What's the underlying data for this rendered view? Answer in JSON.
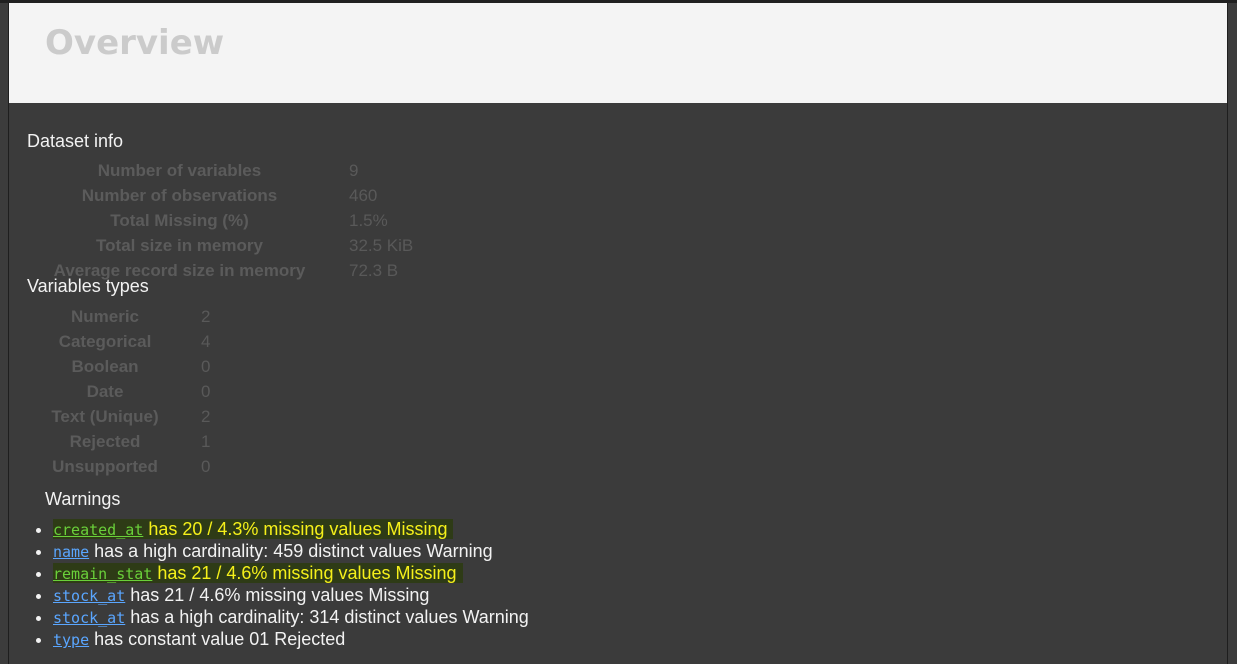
{
  "header": {
    "title": "Overview"
  },
  "dataset_info": {
    "title": "Dataset info",
    "rows": [
      {
        "label": "Number of variables",
        "value": "9"
      },
      {
        "label": "Number of observations",
        "value": "460"
      },
      {
        "label": "Total Missing (%)",
        "value": "1.5%"
      },
      {
        "label": "Total size in memory",
        "value": "32.5 KiB"
      },
      {
        "label": "Average record size in memory",
        "value": "72.3 B"
      }
    ]
  },
  "variable_types": {
    "title": "Variables types",
    "rows": [
      {
        "label": "Numeric",
        "value": "2"
      },
      {
        "label": "Categorical",
        "value": "4"
      },
      {
        "label": "Boolean",
        "value": "0"
      },
      {
        "label": "Date",
        "value": "0"
      },
      {
        "label": "Text (Unique)",
        "value": "2"
      },
      {
        "label": "Rejected",
        "value": "1"
      },
      {
        "label": "Unsupported",
        "value": "0"
      }
    ]
  },
  "warnings": {
    "title": "Warnings",
    "items": [
      {
        "variable": "created_at",
        "text": "has 20 / 4.3% missing values Missing",
        "highlighted": true
      },
      {
        "variable": "name",
        "text": "has a high cardinality: 459 distinct values Warning",
        "highlighted": false
      },
      {
        "variable": "remain_stat",
        "text": "has 21 / 4.6% missing values Missing",
        "highlighted": true
      },
      {
        "variable": "stock_at",
        "text": "has 21 / 4.6% missing values Missing",
        "highlighted": false
      },
      {
        "variable": "stock_at",
        "text": "has a high cardinality: 314 distinct values Warning",
        "highlighted": false
      },
      {
        "variable": "type",
        "text": "has constant value 01 Rejected",
        "highlighted": false
      }
    ]
  },
  "colors": {
    "highlight_bg": "#2e3b16",
    "highlight_text": "#f5f01a",
    "link": "#5aa6ff"
  }
}
